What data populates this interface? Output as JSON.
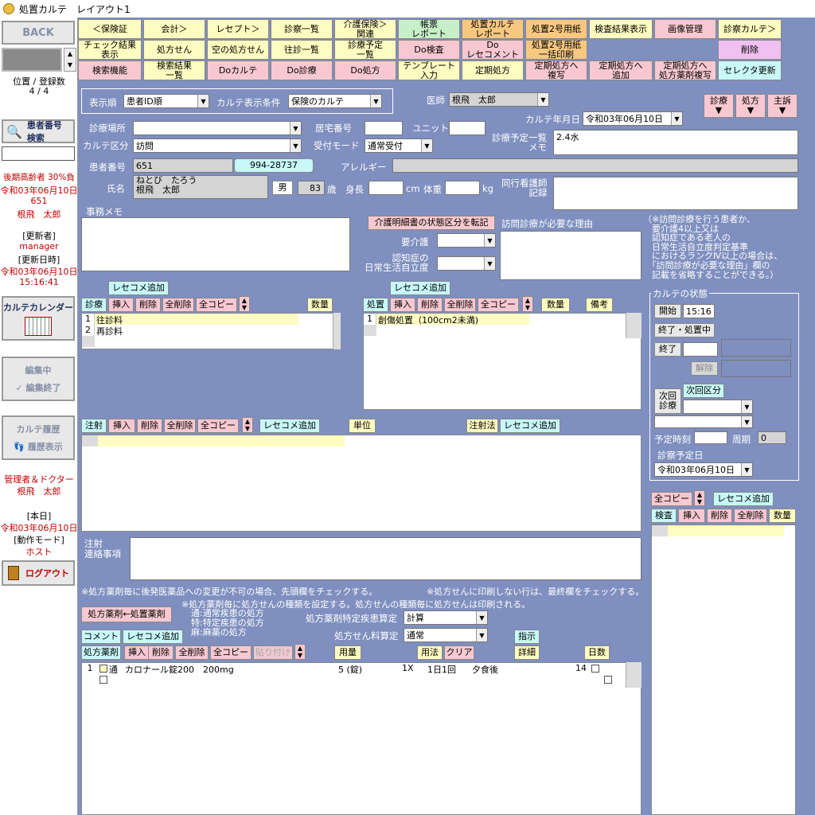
{
  "window": {
    "title": "処置カルテ　レイアウト1"
  },
  "left": {
    "back": "BACK",
    "position_label": "位置 / 登録数",
    "position_value": "4 / 4",
    "patient_search": "患者番号\n検索",
    "insurance": "後期高齢者 30%負",
    "date1": "令和03年06月10日",
    "pid": "651",
    "name": "根飛　太郎",
    "updater_label": "[更新者]",
    "updater": "manager",
    "updated_label": "[更新日時]",
    "updated_date": "令和03年06月10日",
    "updated_time": "15:16:41",
    "calendar": "カルテカレンダー",
    "editing": "編集中",
    "edit_end": "編集終了",
    "history": "カルテ履歴",
    "history_show": "履歴表示",
    "role": "管理者＆ドクター",
    "role_name": "根飛　太郎",
    "today_label": "[本日]",
    "today": "令和03年06月10日",
    "mode_label": "[動作モード]",
    "mode": "ホスト",
    "logout": "ログアウト"
  },
  "topbar": {
    "row1": [
      "＜保険証",
      "会計＞",
      "レセプト＞",
      "診察一覧",
      "介護保険＞\n関連",
      "帳票\nレポート",
      "処置カルテ\nレポート",
      "処置2号用紙",
      "検査結果表示",
      "画像管理",
      "診察カルテ＞"
    ],
    "row2": [
      "チェック結果\n表示",
      "処方せん",
      "空の処方せん",
      "往診一覧",
      "診療予定\n一覧",
      "Do検査",
      "Do\nレセコメント",
      "処置2号用紙\n一括印刷",
      "削除"
    ],
    "row3": [
      "検索機能",
      "検索結果\n一覧",
      "Doカルテ",
      "Do診療",
      "Do処方",
      "テンプレート\n入力",
      "定期処方",
      "定期処方へ\n複写",
      "定期処方へ\n追加",
      "定期処方へ\n処方薬剤複写",
      "セレクタ更新"
    ]
  },
  "form": {
    "order_label": "表示順",
    "order": "患者ID順",
    "cond_label": "カルテ表示条件",
    "cond": "保険のカルテ",
    "doctor_label": "医師",
    "doctor": "根飛　太郎",
    "shinryo": "診療",
    "shoho": "処方",
    "shuso": "主訴",
    "date_label": "カルテ年月日",
    "date": "令和03年06月10日",
    "place_label": "診療場所",
    "kyotaku_label": "居宅番号",
    "unit_label": "ユニット",
    "kubun_label": "カルテ区分",
    "kubun": "訪問",
    "uketsuke_label": "受付モード",
    "uketsuke": "通常受付",
    "yotei_label": "診療予定一覧\nメモ",
    "yotei": "2.4水",
    "pno_label": "患者番号",
    "pno": "651",
    "phone": "994-28737",
    "allergy_label": "アレルギー",
    "name_label": "氏名",
    "kana": "ねとび　たろう",
    "kanji": "根飛　太郎",
    "sex": "男",
    "age": "83",
    "age_unit": "歳",
    "height_label": "身長",
    "height_unit": "cm",
    "weight_label": "体重",
    "weight_unit": "kg",
    "nurse_label": "同行看護師\n記録",
    "memo_label": "事務メモ",
    "kaigo_btn": "介護明細書の状態区分を転記",
    "houmon_label": "訪問診療が必要な理由",
    "youkaigo_label": "要介護",
    "ninchi_label": "認知症の\n日常生活自立度",
    "note": "（※訪問診療を行う患者か、\n　要介護4以上又は\n　認知症である老人の\n　日常生活自立度判定基準\n　におけるランクⅣ以上の場合は、\n　「訪問診療が必要な理由」欄の\n　記載を省略することができる。）"
  },
  "shinryo_panel": {
    "rececome": "レセコメ追加",
    "title": "診療",
    "ins": "挿入",
    "del": "削除",
    "delall": "全削除",
    "copyall": "全コピー",
    "qty": "数量",
    "rows": [
      {
        "n": "1",
        "v": "往診料"
      },
      {
        "n": "2",
        "v": "再診料"
      }
    ]
  },
  "shochi_panel": {
    "rececome": "レセコメ追加",
    "title": "処置",
    "ins": "挿入",
    "del": "削除",
    "delall": "全削除",
    "copyall": "全コピー",
    "qty": "数量",
    "bikou": "備考",
    "rows": [
      {
        "n": "1",
        "v": "創傷処置（100cm2未満)"
      }
    ]
  },
  "chusha_panel": {
    "title": "注射",
    "ins": "挿入",
    "del": "削除",
    "delall": "全削除",
    "copyall": "全コピー",
    "rececome": "レセコメ追加",
    "unit": "単位",
    "method": "注射法",
    "rececome2": "レセコメ追加"
  },
  "chusha_memo": "注射\n連絡事項",
  "status": {
    "title": "カルテの状態",
    "start": "開始",
    "start_time": "15:16",
    "end_shochi": "終了・処置中",
    "end": "終了",
    "kaijo": "解除",
    "next": "次回\n診療",
    "next_kubun": "次回区分",
    "yotei_time": "予定時刻",
    "shuki": "周期",
    "shuki_val": "0",
    "yotei_date_label": "診察予定日",
    "yotei_date": "令和03年06月10日"
  },
  "kensa": {
    "copyall": "全コピー",
    "rececome": "レセコメ追加",
    "title": "検査",
    "ins": "挿入",
    "del": "削除",
    "delall": "全削除",
    "qty": "数量"
  },
  "presc": {
    "note1": "※処方薬剤毎に後発医薬品への変更が不可の場合、先頭欄をチェックする。",
    "note2": "※処方せんに印刷しない行は、最終欄をチェックする。",
    "btn_move": "処方薬剤←処置薬剤",
    "note3": "※処方薬剤毎に処方せんの種類を設定する。処方せんの種類毎に処方せんは印刷される。",
    "legend": "通:通常疾患の処方\n特:特定疾患の処方\n麻:麻薬の処方",
    "tokutei_label": "処方薬剤特定疾患算定",
    "tokutei": "計算",
    "ryo_label": "処方せん料算定",
    "ryo": "通常",
    "comment": "コメント",
    "rececome": "レセコメ追加",
    "shiji": "指示",
    "title": "処方薬剤",
    "ins": "挿入",
    "del": "削除",
    "delall": "全削除",
    "copyall": "全コピー",
    "paste": "貼り付け",
    "yoryo": "用量",
    "yoho": "用法",
    "clear": "クリア",
    "shosai": "詳細",
    "days": "日数",
    "rows": [
      {
        "n": "1",
        "type": "通",
        "drug": "カロナール錠200　200mg",
        "qty": "5 (錠)",
        "yoho": "1X",
        "yoho2": "1日1回",
        "timing": "夕食後",
        "days": "14"
      }
    ]
  }
}
